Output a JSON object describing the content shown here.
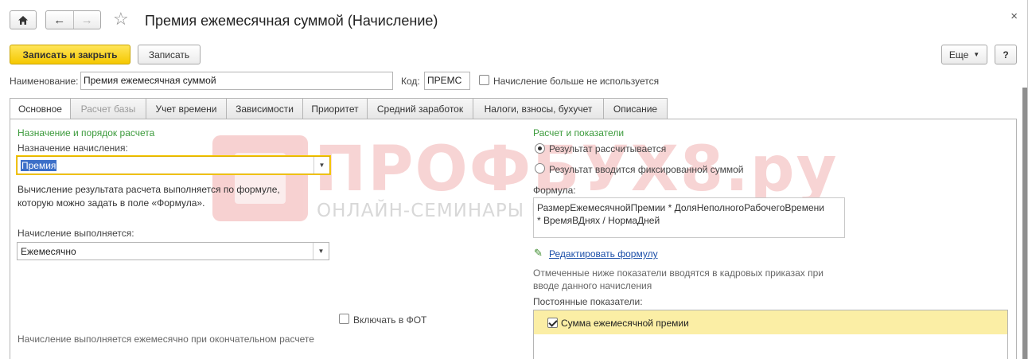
{
  "window": {
    "title": "Премия ежемесячная суммой (Начисление)",
    "close_glyph": "×"
  },
  "toolbar": {
    "save_close_label": "Записать и закрыть",
    "save_label": "Записать",
    "more_label": "Еще",
    "help_label": "?"
  },
  "form": {
    "name_label": "Наименование:",
    "name_value": "Премия ежемесячная суммой",
    "code_label": "Код:",
    "code_value": "ПРЕМС",
    "not_used_label": "Начисление больше не используется"
  },
  "tabs": [
    {
      "label": "Основное",
      "state": "active"
    },
    {
      "label": "Расчет базы",
      "state": "disabled"
    },
    {
      "label": "Учет времени",
      "state": "normal"
    },
    {
      "label": "Зависимости",
      "state": "normal"
    },
    {
      "label": "Приоритет",
      "state": "normal"
    },
    {
      "label": "Средний заработок",
      "state": "normal"
    },
    {
      "label": "Налоги, взносы, бухучет",
      "state": "normal"
    },
    {
      "label": "Описание",
      "state": "normal"
    }
  ],
  "left": {
    "section_title": "Назначение и порядок расчета",
    "purpose_label": "Назначение начисления:",
    "purpose_value": "Премия",
    "formula_note_line1": "Вычисление результата расчета выполняется по формуле,",
    "formula_note_line2": "которую можно задать в поле «Формула».",
    "performed_label": "Начисление выполняется:",
    "performed_value": "Ежемесячно",
    "include_fot_label": "Включать в ФОТ",
    "bottom_note": "Начисление выполняется ежемесячно при окончательном расчете"
  },
  "right": {
    "section_title": "Расчет и показатели",
    "radio_calculated": "Результат рассчитывается",
    "radio_fixed": "Результат вводится фиксированной суммой",
    "formula_label": "Формула:",
    "formula_line1": "РазмерЕжемесячнойПремии * ДоляНеполногоРабочегоВремени",
    "formula_line2": "* ВремяВДнях / НормаДней",
    "edit_formula_link": "Редактировать формулу",
    "marked_note_line1": "Отмеченные ниже показатели вводятся в кадровых приказах при",
    "marked_note_line2": "вводе данного начисления",
    "constant_label": "Постоянные показатели:",
    "indicators": [
      {
        "label": "Сумма ежемесячной премии",
        "checked": true
      }
    ]
  },
  "watermark": {
    "main": "ПРОФБУХ8.ру",
    "sub": "ОНЛАЙН-СЕМИНАРЫ И ВИДЕОКУРСЫ 1С:8"
  },
  "colors": {
    "primary_button": "#f5c800",
    "section_title": "#3b9a3b",
    "link": "#1a4ea8",
    "highlight_row": "#fbeea5",
    "watermark": "#f2b8b8"
  }
}
